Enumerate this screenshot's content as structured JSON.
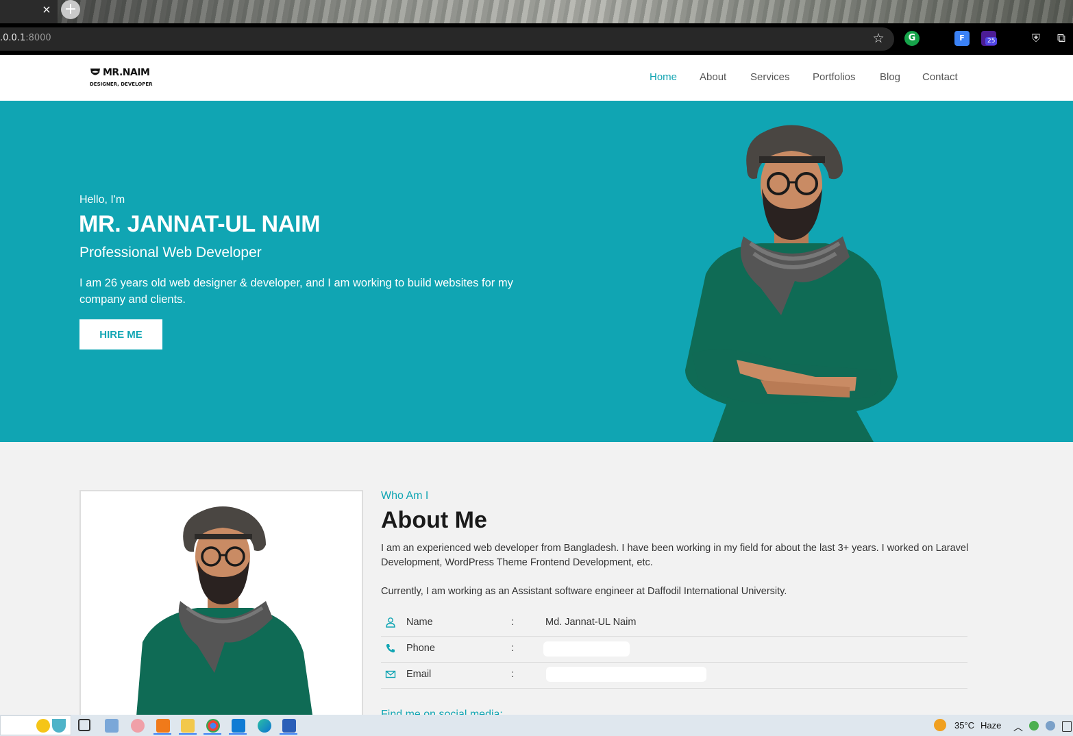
{
  "browser": {
    "url_host": ".0.0.1",
    "url_port": ":8000",
    "tab_close": "×",
    "new_tab": "+",
    "ext_f_label": "F",
    "ext_badge": "25"
  },
  "site": {
    "logo_main": "MR.NAIM",
    "logo_sub": "DESIGNER, DEVELOPER",
    "nav": [
      "Home",
      "About",
      "Services",
      "Portfolios",
      "Blog",
      "Contact"
    ],
    "active_nav": "Home"
  },
  "hero": {
    "greeting": "Hello, I'm",
    "name": "MR. JANNAT-UL NAIM",
    "role": "Professional Web Developer",
    "description": "I am 26 years old web designer & developer, and I am working to build websites for my company and clients.",
    "button": "HIRE ME"
  },
  "about": {
    "eyebrow": "Who Am I",
    "title": "About Me",
    "paragraph1": "I am an experienced web developer from Bangladesh. I have been working in my field for about the last 3+ years. I worked on Laravel Development, WordPress Theme Frontend Development, etc.",
    "paragraph2": "Currently, I am working as an Assistant software engineer at Daffodil International University.",
    "info": [
      {
        "label": "Name",
        "colon": ":",
        "value": "Md. Jannat-UL Naim",
        "icon": "user-icon"
      },
      {
        "label": "Phone",
        "colon": ":",
        "value": "",
        "icon": "phone-icon"
      },
      {
        "label": "Email",
        "colon": ":",
        "value": "",
        "icon": "envelope-icon"
      }
    ],
    "social_heading": "Find me on social media:"
  },
  "taskbar": {
    "temperature": "35°C",
    "weather": "Haze"
  },
  "colors": {
    "accent": "#10a5b3",
    "hero_bg": "#10a5b3",
    "page_bg": "#f2f2f2"
  }
}
